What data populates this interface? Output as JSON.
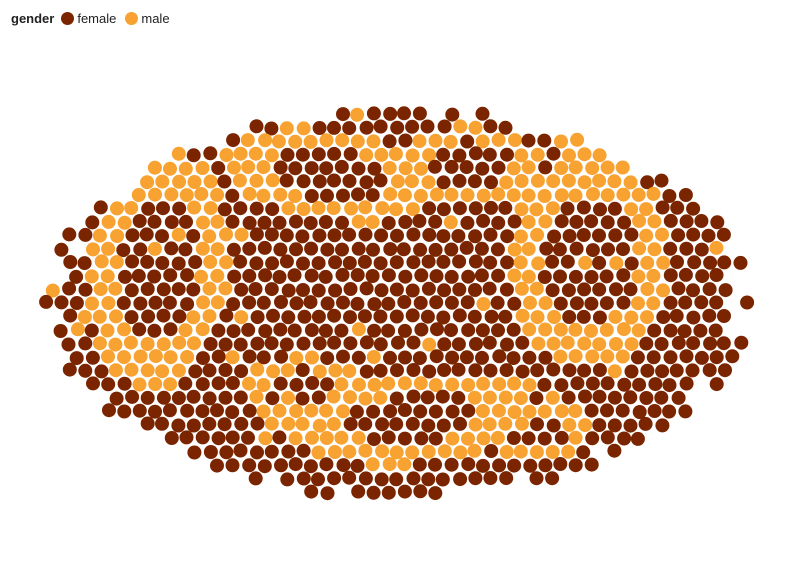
{
  "chart_data": {
    "type": "scatter",
    "title": "",
    "xlabel": "",
    "ylabel": "",
    "grid": false,
    "legend_placement": "top-left",
    "legend": {
      "title": "gender",
      "entries": [
        {
          "label": "female",
          "color": "#7a2500"
        },
        {
          "label": "male",
          "color": "#f7a231"
        }
      ]
    },
    "series": [
      {
        "name": "female",
        "color": "#7a2500",
        "approx_count": 570
      },
      {
        "name": "male",
        "color": "#f7a231",
        "approx_count": 220
      }
    ],
    "encoding": "beeswarm packed ellipse, one dot per record, colored by gender"
  }
}
